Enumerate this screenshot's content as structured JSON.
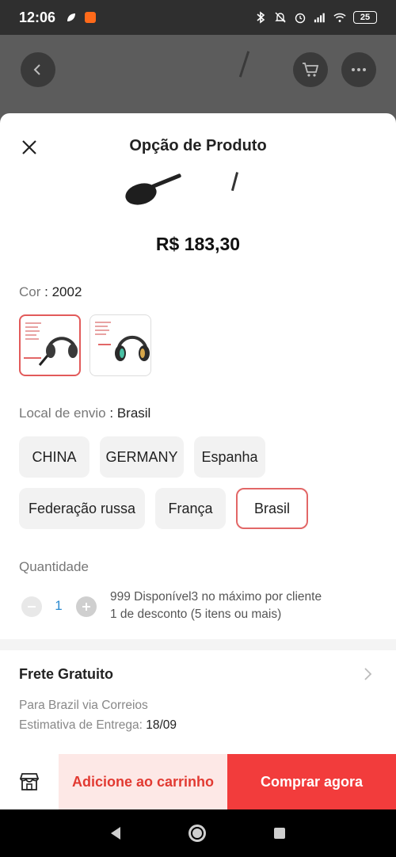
{
  "status_bar": {
    "time": "12:06",
    "battery": "25",
    "left_icons": [
      "leaf-icon",
      "app-notification-icon"
    ],
    "right_icons": [
      "bluetooth-icon",
      "mute-icon",
      "alarm-icon",
      "signal-icon",
      "wifi-icon",
      "battery-icon"
    ]
  },
  "sheet": {
    "title": "Opção de Produto",
    "price": "R$ 183,30"
  },
  "color": {
    "label": "Cor",
    "separator": " : ",
    "value": "2002",
    "options": [
      {
        "name": "headset-rgb-mic-variant",
        "selected": true
      },
      {
        "name": "headset-rgb-light-variant",
        "selected": false
      }
    ]
  },
  "ship_from": {
    "label": "Local de envio",
    "separator": " : ",
    "value": "Brasil",
    "options": [
      "CHINA",
      "GERMANY",
      "Espanha",
      "Federação russa",
      "França",
      "Brasil"
    ],
    "selected": "Brasil"
  },
  "quantity": {
    "label": "Quantidade",
    "value": "1",
    "info_line1": "999 Disponível3 no máximo por cliente",
    "info_line2": "1 de desconto (5 itens ou mais)"
  },
  "shipping": {
    "title": "Frete Gratuito",
    "via": "Para Brazil via Correios",
    "estimate_label": "Estimativa de Entrega: ",
    "estimate_date": "18/09"
  },
  "actions": {
    "add_to_cart": "Adicione ao carrinho",
    "buy_now": "Comprar agora"
  },
  "colors": {
    "accent_red": "#f23c3c",
    "accent_light": "#fde8e6",
    "selected_border": "#e26767"
  }
}
